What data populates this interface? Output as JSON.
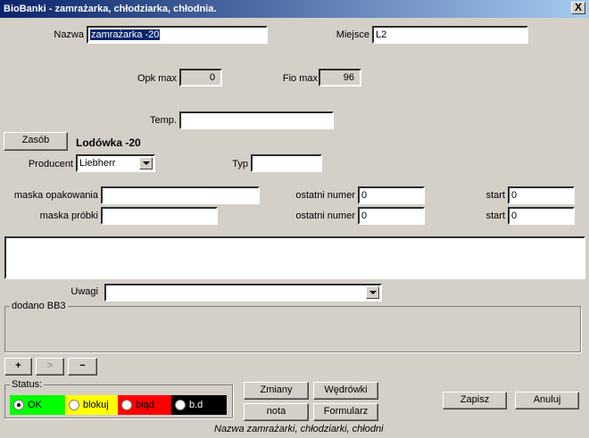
{
  "window": {
    "title": "BioBanki - zamrażarka, chłodziarka, chłodnia.",
    "close_label": "X"
  },
  "form": {
    "nazwa_label": "Nazwa",
    "nazwa_value": "zamrażarka -20",
    "miejsce_label": "Miejsce",
    "miejsce_value": "L2",
    "opk_max_label": "Opk max",
    "opk_max_value": "0",
    "fio_max_label": "Fio max",
    "fio_max_value": "96",
    "temp_label": "Temp.",
    "temp_value": "",
    "zasob_button": "Zasób",
    "zasob_name": "Lodówka -20",
    "producent_label": "Producent",
    "producent_value": "Liebherr",
    "typ_label": "Typ",
    "typ_value": "",
    "maska_opakowania_label": "maska opakowania",
    "maska_opakowania_value": "",
    "maska_probki_label": "maska próbki",
    "maska_probki_value": "",
    "ostatni_numer_label_1": "ostatni numer",
    "ostatni_numer_value_1": "0",
    "ostatni_numer_label_2": "ostatni numer",
    "ostatni_numer_value_2": "0",
    "start_label_1": "start",
    "start_value_1": "0",
    "start_label_2": "start",
    "start_value_2": "0",
    "uwagi_label": "Uwagi",
    "uwagi_value": "",
    "dodano_label": "dodano BB3"
  },
  "nav_buttons": {
    "add": "+",
    "next": ">",
    "remove": "−"
  },
  "status": {
    "label": "Status:",
    "options": [
      {
        "label": "OK",
        "color": "#00ff00",
        "selected": true
      },
      {
        "label": "blokuj",
        "color": "#ffff00",
        "selected": false
      },
      {
        "label": "błąd",
        "color": "#ff0000",
        "selected": false
      },
      {
        "label": "b.d",
        "color": "#000000",
        "selected": false
      }
    ]
  },
  "actions": {
    "zmiany": "Zmiany",
    "wedrowki": "Wędrówki",
    "nota": "nota",
    "formularz": "Formularz",
    "zapisz": "Zapisz",
    "anuluj": "Anuluj"
  },
  "footer_caption": "Nazwa zamrażarki, chłodziarki, chłodni"
}
